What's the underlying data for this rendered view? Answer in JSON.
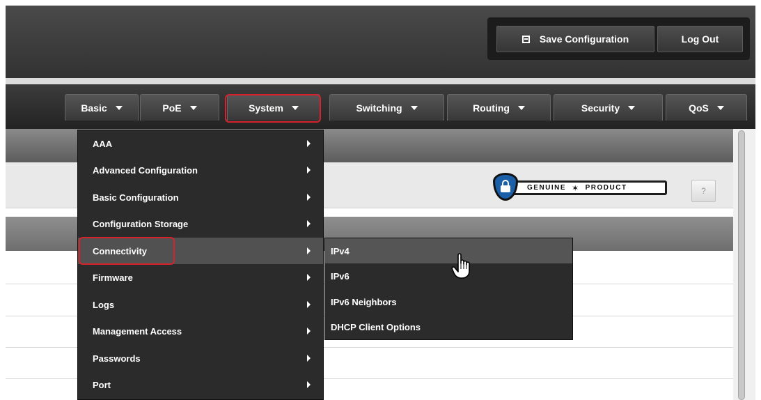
{
  "header": {
    "save_label": "Save Configuration",
    "logout_label": "Log Out"
  },
  "nav": {
    "tabs": [
      {
        "label": "Basic"
      },
      {
        "label": "PoE"
      },
      {
        "label": "System"
      },
      {
        "label": "Switching"
      },
      {
        "label": "Routing"
      },
      {
        "label": "Security"
      },
      {
        "label": "QoS"
      }
    ],
    "active_tab": "System"
  },
  "badge": {
    "left_text": "GENUINE",
    "right_text": "PRODUCT"
  },
  "help": {
    "label": "?"
  },
  "system_menu": {
    "items": [
      {
        "label": "AAA"
      },
      {
        "label": "Advanced Configuration"
      },
      {
        "label": "Basic Configuration"
      },
      {
        "label": "Configuration Storage"
      },
      {
        "label": "Connectivity"
      },
      {
        "label": "Firmware"
      },
      {
        "label": "Logs"
      },
      {
        "label": "Management Access"
      },
      {
        "label": "Passwords"
      },
      {
        "label": "Port"
      }
    ],
    "active_item": "Connectivity"
  },
  "connectivity_submenu": {
    "items": [
      {
        "label": "IPv4"
      },
      {
        "label": "IPv6"
      },
      {
        "label": "IPv6 Neighbors"
      },
      {
        "label": "DHCP Client Options"
      }
    ],
    "hovered_item": "IPv4"
  },
  "colors": {
    "highlight": "#d6222a",
    "menu_bg": "#2b2b2b",
    "badge_shield": "#1a5fa8"
  }
}
